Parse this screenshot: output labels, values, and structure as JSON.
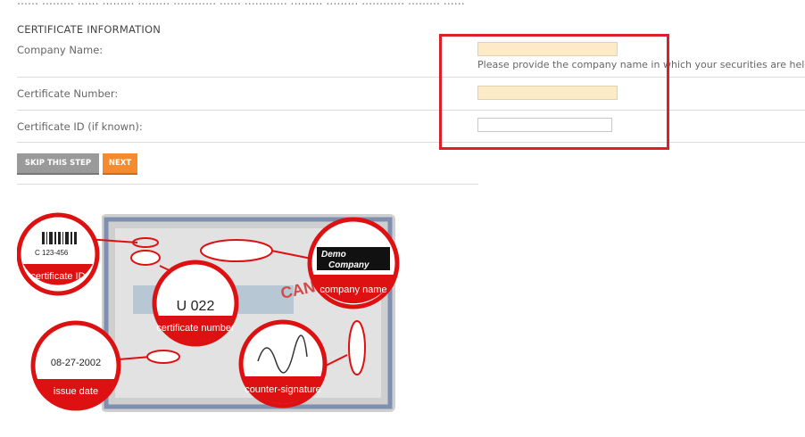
{
  "section_title": "CERTIFICATE INFORMATION",
  "fields": {
    "company_name": {
      "label": "Company Name:",
      "value": "",
      "help": "Please provide the company name in which your securities are held."
    },
    "certificate_number": {
      "label": "Certificate Number:",
      "value": ""
    },
    "certificate_id": {
      "label": "Certificate ID (if known):",
      "value": ""
    }
  },
  "buttons": {
    "skip": "SKIP THIS STEP",
    "next": "NEXT"
  },
  "illustration": {
    "callouts": {
      "certificate_id": "certificate ID",
      "company_name": "company name",
      "certificate_number": "certificate number",
      "issue_date": "issue date",
      "countersignature": "counter-signature"
    },
    "sample_values": {
      "certificate_id": "C 123-456",
      "certificate_number": "U 022",
      "issue_date": "08-27-2002",
      "company_line1": "Demo",
      "company_line2": "Company",
      "cancelled_stamp": "CANC"
    }
  },
  "colors": {
    "required_field_bg": "#fdebc8",
    "highlight_red": "#e01e2a",
    "skip_button": "#9a9a9a",
    "next_button": "#f58a2f"
  }
}
